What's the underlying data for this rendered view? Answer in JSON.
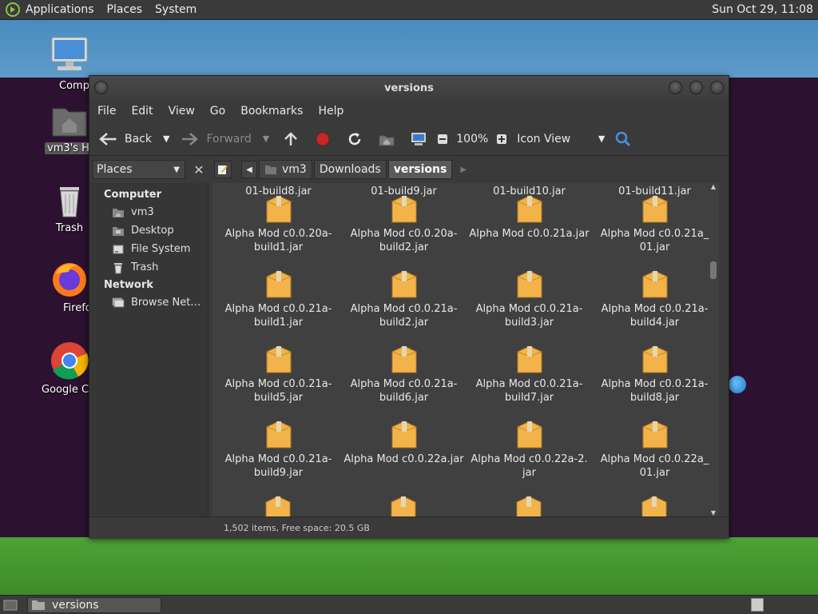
{
  "top_panel": {
    "menus": [
      "Applications",
      "Places",
      "System"
    ],
    "clock": "Sun Oct 29, 11:08"
  },
  "desktop_icons": [
    {
      "label": "Computer"
    },
    {
      "label": "vm3's Home"
    },
    {
      "label": "Trash"
    },
    {
      "label": "Firefox"
    },
    {
      "label": "Google Chrome"
    }
  ],
  "window": {
    "title": "versions",
    "menu": [
      "File",
      "Edit",
      "View",
      "Go",
      "Bookmarks",
      "Help"
    ],
    "toolbar": {
      "back": "Back",
      "forward": "Forward",
      "zoom": "100%",
      "view_mode": "Icon View"
    },
    "location": {
      "places_label": "Places",
      "crumbs": [
        "vm3",
        "Downloads",
        "versions"
      ]
    },
    "sidebar": {
      "computer_header": "Computer",
      "computer_items": [
        "vm3",
        "Desktop",
        "File System",
        "Trash"
      ],
      "network_header": "Network",
      "network_items": [
        "Browse Net…"
      ]
    },
    "files": [
      [
        "01-build8.jar"
      ],
      [
        "01-build9.jar"
      ],
      [
        "01-build10.jar"
      ],
      [
        "01-build11.jar"
      ],
      [
        "Alpha Mod c0.0.20a-",
        "build1.jar"
      ],
      [
        "Alpha Mod c0.0.20a-",
        "build2.jar"
      ],
      [
        "Alpha Mod c0.0.21a.jar"
      ],
      [
        "Alpha Mod c0.0.21a_",
        "01.jar"
      ],
      [
        "Alpha Mod c0.0.21a-",
        "build1.jar"
      ],
      [
        "Alpha Mod c0.0.21a-",
        "build2.jar"
      ],
      [
        "Alpha Mod c0.0.21a-",
        "build3.jar"
      ],
      [
        "Alpha Mod c0.0.21a-",
        "build4.jar"
      ],
      [
        "Alpha Mod c0.0.21a-",
        "build5.jar"
      ],
      [
        "Alpha Mod c0.0.21a-",
        "build6.jar"
      ],
      [
        "Alpha Mod c0.0.21a-",
        "build7.jar"
      ],
      [
        "Alpha Mod c0.0.21a-",
        "build8.jar"
      ],
      [
        "Alpha Mod c0.0.21a-",
        "build9.jar"
      ],
      [
        "Alpha Mod c0.0.22a.jar"
      ],
      [
        "Alpha Mod c0.0.22a-2.",
        "jar"
      ],
      [
        "Alpha Mod c0.0.22a_",
        "01.jar"
      ]
    ],
    "status": "1,502 items, Free space: 20.5 GB"
  },
  "taskbar": {
    "task_label": "versions"
  },
  "colors": {
    "jar_fill": "#f2b44a",
    "window_bg": "#3a3a3a",
    "content_bg": "#404040"
  }
}
